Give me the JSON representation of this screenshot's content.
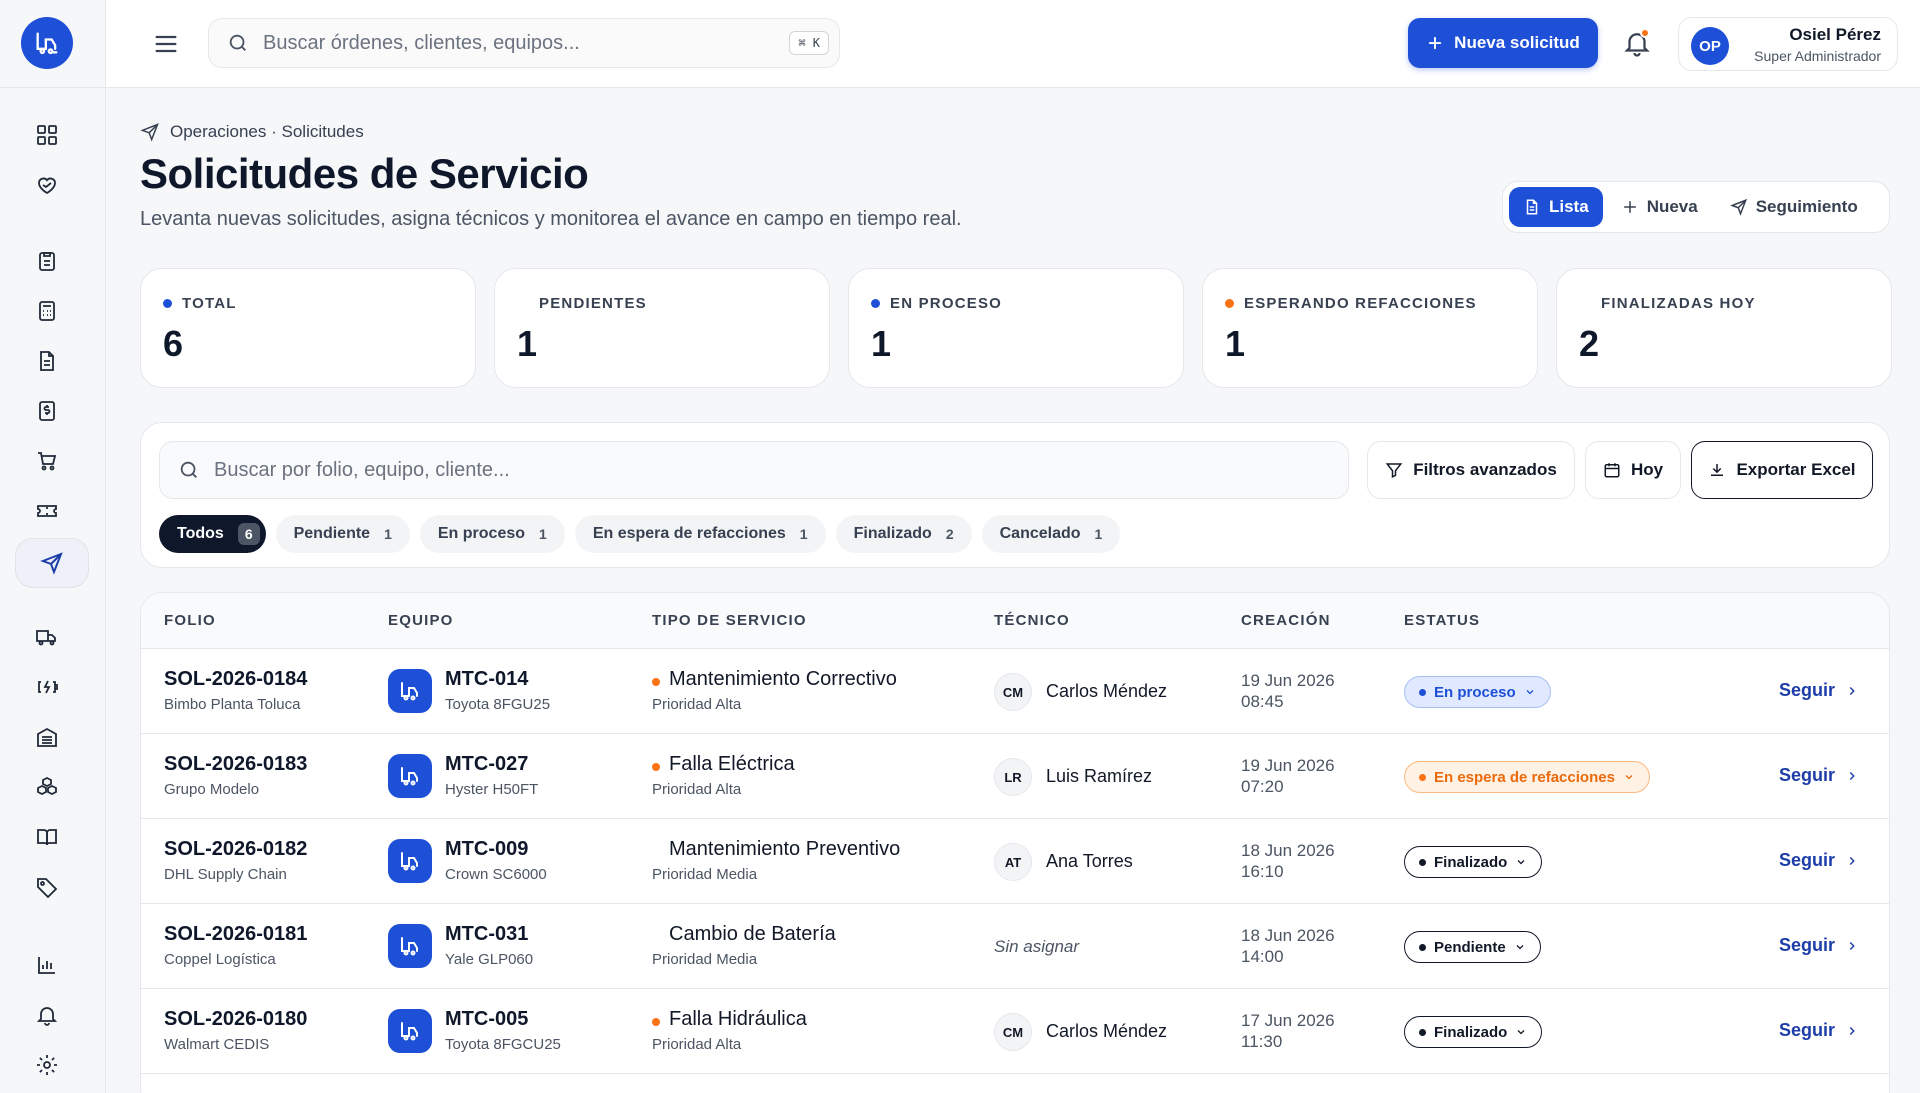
{
  "topbar": {
    "search_placeholder": "Buscar órdenes, clientes, equipos...",
    "shortcut": "⌘ K",
    "new_request_label": "Nueva solicitud",
    "user": {
      "initials": "OP",
      "name": "Osiel Pérez",
      "role": "Super Administrador"
    }
  },
  "header": {
    "breadcrumb": "Operaciones · Solicitudes",
    "title": "Solicitudes de Servicio",
    "subtitle": "Levanta nuevas solicitudes, asigna técnicos y monitorea el avance en campo en tiempo real.",
    "view_tabs": [
      {
        "label": "Lista",
        "active": true
      },
      {
        "label": "Nueva",
        "active": false
      },
      {
        "label": "Seguimiento",
        "active": false
      }
    ]
  },
  "stats": [
    {
      "label": "TOTAL",
      "value": "6",
      "dot_color": "#1d4fd7"
    },
    {
      "label": "PENDIENTES",
      "value": "1",
      "dot_color": ""
    },
    {
      "label": "EN PROCESO",
      "value": "1",
      "dot_color": "#1d4fd7"
    },
    {
      "label": "ESPERANDO REFACCIONES",
      "value": "1",
      "dot_color": "#f97316"
    },
    {
      "label": "FINALIZADAS HOY",
      "value": "2",
      "dot_color": ""
    }
  ],
  "filters": {
    "search_placeholder": "Buscar por folio, equipo, cliente...",
    "advanced_label": "Filtros avanzados",
    "today_label": "Hoy",
    "export_label": "Exportar Excel",
    "chips": [
      {
        "label": "Todos",
        "count": "6"
      },
      {
        "label": "Pendiente",
        "count": "1"
      },
      {
        "label": "En proceso",
        "count": "1"
      },
      {
        "label": "En espera de refacciones",
        "count": "1"
      },
      {
        "label": "Finalizado",
        "count": "2"
      },
      {
        "label": "Cancelado",
        "count": "1"
      }
    ]
  },
  "table": {
    "headers": [
      "FOLIO",
      "EQUIPO",
      "TIPO DE SERVICIO",
      "TÉCNICO",
      "CREACIÓN",
      "ESTATUS"
    ],
    "action_label": "Seguir",
    "rows": [
      {
        "folio": "SOL-2026-0184",
        "client": "Bimbo Planta Toluca",
        "equipment": "MTC-014",
        "model": "Toyota 8FGU25",
        "service": "Mantenimiento Correctivo",
        "priority": "Prioridad Alta",
        "tech_initials": "CM",
        "tech": "Carlos Méndez",
        "date": "19 Jun 2026",
        "time": "08:45",
        "status": "En proceso"
      },
      {
        "folio": "SOL-2026-0183",
        "client": "Grupo Modelo",
        "equipment": "MTC-027",
        "model": "Hyster H50FT",
        "service": "Falla Eléctrica",
        "priority": "Prioridad Alta",
        "tech_initials": "LR",
        "tech": "Luis Ramírez",
        "date": "19 Jun 2026",
        "time": "07:20",
        "status": "En espera de refacciones"
      },
      {
        "folio": "SOL-2026-0182",
        "client": "DHL Supply Chain",
        "equipment": "MTC-009",
        "model": "Crown SC6000",
        "service": "Mantenimiento Preventivo",
        "priority": "Prioridad Media",
        "tech_initials": "AT",
        "tech": "Ana Torres",
        "date": "18 Jun 2026",
        "time": "16:10",
        "status": "Finalizado"
      },
      {
        "folio": "SOL-2026-0181",
        "client": "Coppel Logística",
        "equipment": "MTC-031",
        "model": "Yale GLP060",
        "service": "Cambio de Batería",
        "priority": "Prioridad Media",
        "tech_initials": "",
        "tech": "Sin asignar",
        "date": "18 Jun 2026",
        "time": "14:00",
        "status": "Pendiente"
      },
      {
        "folio": "SOL-2026-0180",
        "client": "Walmart CEDIS",
        "equipment": "MTC-005",
        "model": "Toyota 8FGCU25",
        "service": "Falla Hidráulica",
        "priority": "Prioridad Alta",
        "tech_initials": "CM",
        "tech": "Carlos Méndez",
        "date": "17 Jun 2026",
        "time": "11:30",
        "status": "Finalizado"
      }
    ]
  }
}
